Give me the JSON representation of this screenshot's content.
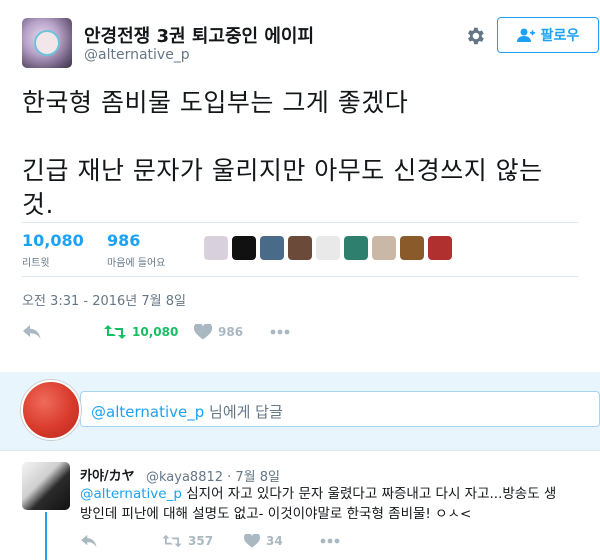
{
  "tweet": {
    "author_name": "안경전쟁 3권 퇴고중인 에이피",
    "screen_name": "@alternative_p",
    "follow_label": "팔로우",
    "text_lines": [
      "한국형 좀비물 도입부는 그게 좋겠다",
      "긴급 재난 문자가 울리지만 아무도 신경쓰지 않는 것."
    ],
    "retweets_count": "10,080",
    "retweets_label": "리트윗",
    "likes_count": "986",
    "likes_label": "마음에 들어요",
    "timestamp": "오전 3:31 - 2016년 7월 8일",
    "action_retweet_count": "10,080",
    "action_like_count": "986"
  },
  "reply_box": {
    "mention": "@alternative_p",
    "suffix": " 님에게 답글"
  },
  "reply": {
    "author_name": "카야/カヤ",
    "handle_time": "@kaya8812 · 7월 8일",
    "mention": "@alternative_p",
    "line1": " 심지어 자고 있다가 문자 울렸다고 짜증내고 다시 자고...방송도 생",
    "line2": "방인데 피난에 대해 설명도 없고- 이것이야말로 한국형 좀비물! ㅇㅅ<",
    "retweet_count": "357",
    "like_count": "34"
  },
  "colors": {
    "accent": "#1da1f2",
    "retweet_green": "#17bf63",
    "muted": "#657786",
    "reply_bg": "#e8f5fd"
  },
  "liker_colors": [
    "#d8d0dc",
    "#111111",
    "#4a6a8a",
    "#6b4a3a",
    "#e9e9e9",
    "#2f7f6f",
    "#c9b8a6",
    "#8a5a2a",
    "#b03030"
  ]
}
